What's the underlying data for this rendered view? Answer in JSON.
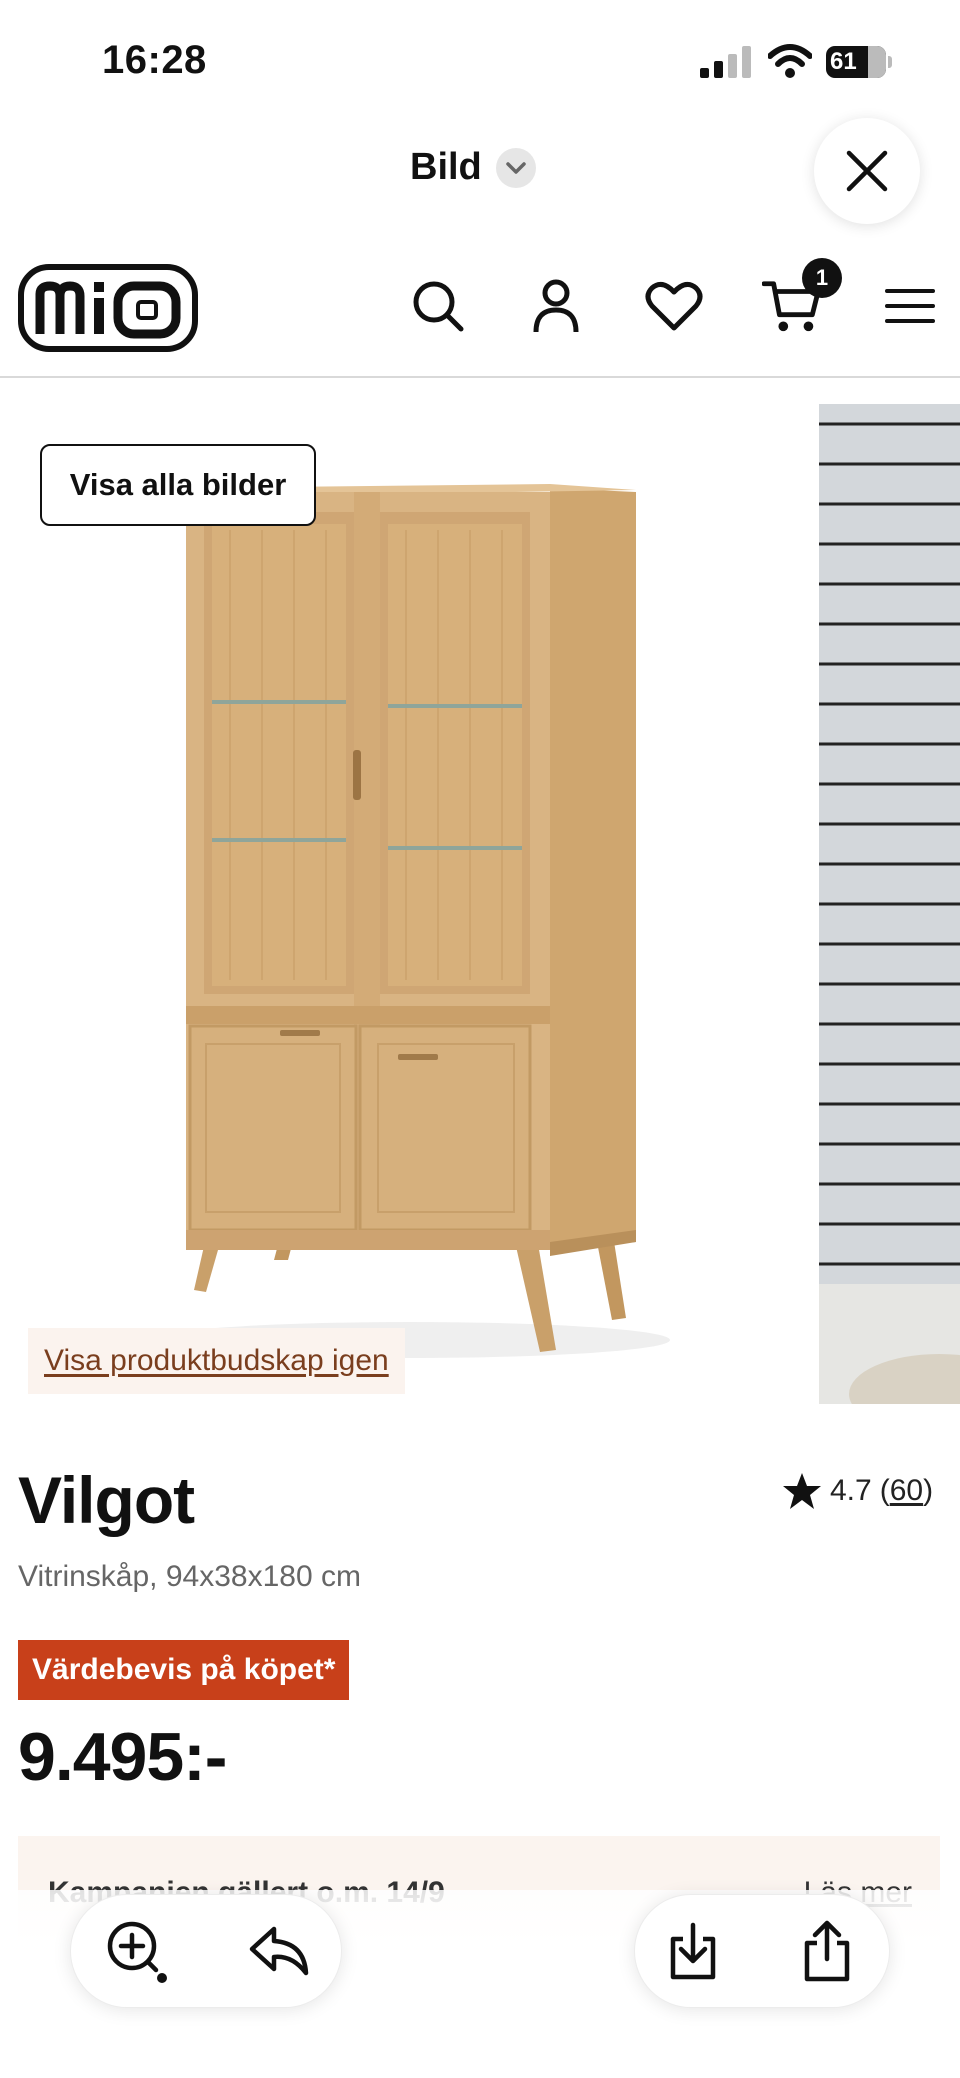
{
  "status_bar": {
    "time": "16:28",
    "battery_level": "61",
    "icons": [
      "signal-icon",
      "wifi-icon",
      "battery-icon"
    ]
  },
  "viewer": {
    "title": "Bild",
    "icons": [
      "chevron-down-icon",
      "close-icon"
    ]
  },
  "site_header": {
    "logo_text": "mio",
    "cart_count": "1",
    "icons": [
      "search-icon",
      "account-icon",
      "heart-icon",
      "cart-icon",
      "menu-icon"
    ]
  },
  "gallery": {
    "show_all_label": "Visa alla bilder",
    "product_message_link": "Visa produktbudskap igen"
  },
  "product": {
    "title": "Vilgot",
    "subtitle": "Vitrinskåp, 94x38x180 cm",
    "rating": "4.7",
    "rating_count_open": "(",
    "rating_count": "60",
    "rating_count_close": ")",
    "badge": "Värdebevis på köpet*",
    "price": "9.495:-"
  },
  "campaign": {
    "text": "Kampanjen gällert o.m. 14/9",
    "link": "Läs mer"
  },
  "toolbar": {
    "icons": [
      "zoom-in-icon",
      "reply-icon",
      "download-icon",
      "share-icon"
    ]
  },
  "colors": {
    "badge": "#c8401a",
    "link_brown": "#7a3e1e",
    "banner_bg": "#fbf4ef",
    "wood": "#d9b483"
  }
}
